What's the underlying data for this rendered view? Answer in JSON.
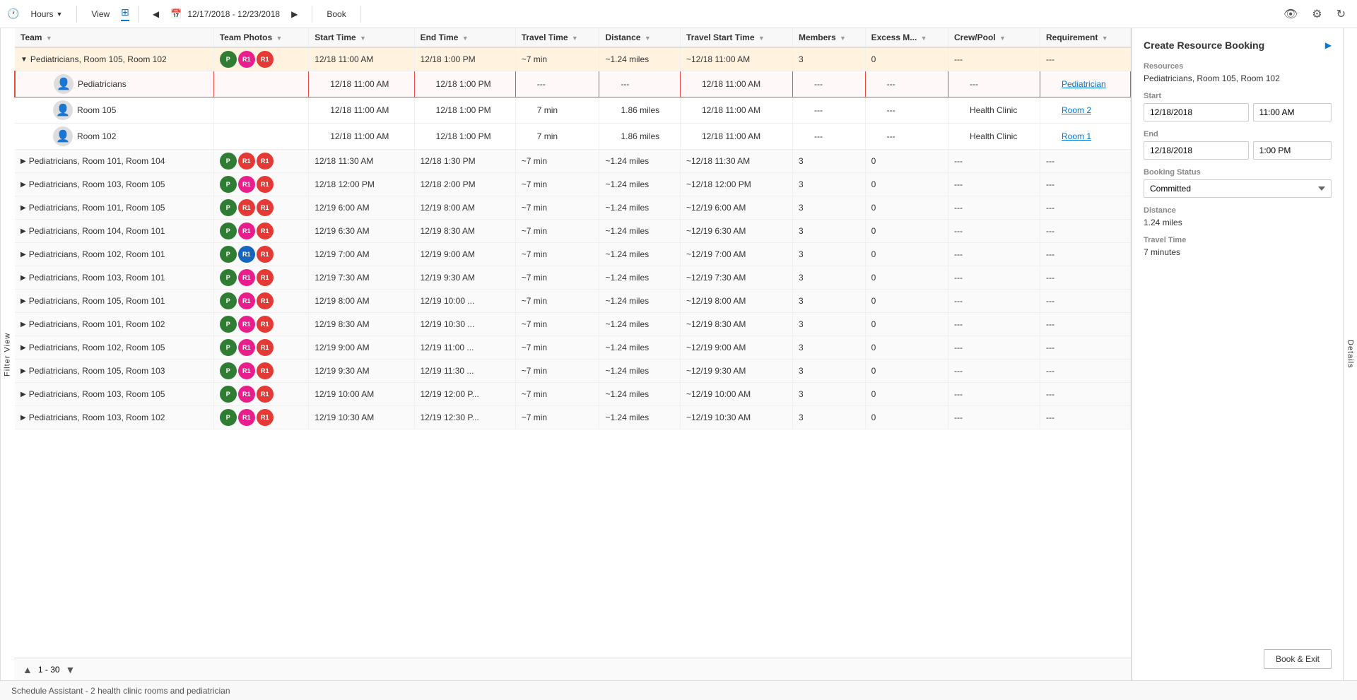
{
  "toolbar": {
    "hours_label": "Hours",
    "view_label": "View",
    "date_range": "12/17/2018 - 12/23/2018",
    "book_label": "Book"
  },
  "filter_tab": "Filter View",
  "details_tab": "Details",
  "columns": [
    {
      "key": "team",
      "label": "Team"
    },
    {
      "key": "team_photos",
      "label": "Team Photos"
    },
    {
      "key": "start_time",
      "label": "Start Time"
    },
    {
      "key": "end_time",
      "label": "End Time"
    },
    {
      "key": "travel_time",
      "label": "Travel Time"
    },
    {
      "key": "distance",
      "label": "Distance"
    },
    {
      "key": "travel_start_time",
      "label": "Travel Start Time"
    },
    {
      "key": "members",
      "label": "Members"
    },
    {
      "key": "excess_m",
      "label": "Excess M..."
    },
    {
      "key": "crew_pool",
      "label": "Crew/Pool"
    },
    {
      "key": "requirement",
      "label": "Requirement"
    }
  ],
  "rows": [
    {
      "id": "group1",
      "type": "group",
      "expanded": true,
      "team": "Pediatricians, Room 105, Room 102",
      "avatars": [
        {
          "letter": "P",
          "color": "green"
        },
        {
          "letter": "R1",
          "color": "pink"
        },
        {
          "letter": "R1",
          "color": "red"
        }
      ],
      "start_time": "12/18 11:00 AM",
      "end_time": "12/18 1:00 PM",
      "travel_time": "~7 min",
      "distance": "~1.24 miles",
      "travel_start_time": "~12/18 11:00 AM",
      "members": "3",
      "excess_m": "0",
      "crew_pool": "---",
      "requirement": "---"
    },
    {
      "id": "child1",
      "type": "child",
      "selected": true,
      "team": "Pediatricians",
      "person_icon": true,
      "avatars": [],
      "start_time": "12/18 11:00 AM",
      "end_time": "12/18 1:00 PM",
      "travel_time": "---",
      "distance": "---",
      "travel_start_time": "12/18 11:00 AM",
      "members": "---",
      "excess_m": "---",
      "crew_pool": "---",
      "requirement": "Pediatrician",
      "req_link": true
    },
    {
      "id": "child2",
      "type": "child",
      "team": "Room 105",
      "person_icon": true,
      "avatars": [],
      "start_time": "12/18 11:00 AM",
      "end_time": "12/18 1:00 PM",
      "travel_time": "7 min",
      "distance": "1.86 miles",
      "travel_start_time": "12/18 11:00 AM",
      "members": "---",
      "excess_m": "---",
      "crew_pool": "Health Clinic",
      "requirement": "Room 2",
      "req_link": true
    },
    {
      "id": "child3",
      "type": "child",
      "team": "Room 102",
      "person_icon": true,
      "avatars": [],
      "start_time": "12/18 11:00 AM",
      "end_time": "12/18 1:00 PM",
      "travel_time": "7 min",
      "distance": "1.86 miles",
      "travel_start_time": "12/18 11:00 AM",
      "members": "---",
      "excess_m": "---",
      "crew_pool": "Health Clinic",
      "requirement": "Room 1",
      "req_link": true
    },
    {
      "id": "group2",
      "type": "group",
      "expanded": false,
      "team": "Pediatricians, Room 101, Room 104",
      "avatars": [
        {
          "letter": "P",
          "color": "green"
        },
        {
          "letter": "R1",
          "color": "red"
        },
        {
          "letter": "R1",
          "color": "red"
        }
      ],
      "start_time": "12/18 11:30 AM",
      "end_time": "12/18 1:30 PM",
      "travel_time": "~7 min",
      "distance": "~1.24 miles",
      "travel_start_time": "~12/18 11:30 AM",
      "members": "3",
      "excess_m": "0",
      "crew_pool": "---",
      "requirement": "---"
    },
    {
      "id": "group3",
      "type": "group",
      "expanded": false,
      "team": "Pediatricians, Room 103, Room 105",
      "avatars": [
        {
          "letter": "P",
          "color": "green"
        },
        {
          "letter": "R1",
          "color": "pink"
        },
        {
          "letter": "R1",
          "color": "red"
        }
      ],
      "start_time": "12/18 12:00 PM",
      "end_time": "12/18 2:00 PM",
      "travel_time": "~7 min",
      "distance": "~1.24 miles",
      "travel_start_time": "~12/18 12:00 PM",
      "members": "3",
      "excess_m": "0",
      "crew_pool": "---",
      "requirement": "---"
    },
    {
      "id": "group4",
      "type": "group",
      "expanded": false,
      "team": "Pediatricians, Room 101, Room 105",
      "avatars": [
        {
          "letter": "P",
          "color": "green"
        },
        {
          "letter": "R1",
          "color": "red"
        },
        {
          "letter": "R1",
          "color": "red"
        }
      ],
      "start_time": "12/19 6:00 AM",
      "end_time": "12/19 8:00 AM",
      "travel_time": "~7 min",
      "distance": "~1.24 miles",
      "travel_start_time": "~12/19 6:00 AM",
      "members": "3",
      "excess_m": "0",
      "crew_pool": "---",
      "requirement": "---"
    },
    {
      "id": "group5",
      "type": "group",
      "expanded": false,
      "team": "Pediatricians, Room 104, Room 101",
      "avatars": [
        {
          "letter": "P",
          "color": "green"
        },
        {
          "letter": "R1",
          "color": "pink"
        },
        {
          "letter": "R1",
          "color": "red"
        }
      ],
      "start_time": "12/19 6:30 AM",
      "end_time": "12/19 8:30 AM",
      "travel_time": "~7 min",
      "distance": "~1.24 miles",
      "travel_start_time": "~12/19 6:30 AM",
      "members": "3",
      "excess_m": "0",
      "crew_pool": "---",
      "requirement": "---"
    },
    {
      "id": "group6",
      "type": "group",
      "expanded": false,
      "team": "Pediatricians, Room 102, Room 101",
      "avatars": [
        {
          "letter": "P",
          "color": "green"
        },
        {
          "letter": "R1",
          "color": "blue"
        },
        {
          "letter": "R1",
          "color": "red"
        }
      ],
      "start_time": "12/19 7:00 AM",
      "end_time": "12/19 9:00 AM",
      "travel_time": "~7 min",
      "distance": "~1.24 miles",
      "travel_start_time": "~12/19 7:00 AM",
      "members": "3",
      "excess_m": "0",
      "crew_pool": "---",
      "requirement": "---"
    },
    {
      "id": "group7",
      "type": "group",
      "expanded": false,
      "team": "Pediatricians, Room 103, Room 101",
      "avatars": [
        {
          "letter": "P",
          "color": "green"
        },
        {
          "letter": "R1",
          "color": "pink"
        },
        {
          "letter": "R1",
          "color": "red"
        }
      ],
      "start_time": "12/19 7:30 AM",
      "end_time": "12/19 9:30 AM",
      "travel_time": "~7 min",
      "distance": "~1.24 miles",
      "travel_start_time": "~12/19 7:30 AM",
      "members": "3",
      "excess_m": "0",
      "crew_pool": "---",
      "requirement": "---"
    },
    {
      "id": "group8",
      "type": "group",
      "expanded": false,
      "team": "Pediatricians, Room 105, Room 101",
      "avatars": [
        {
          "letter": "P",
          "color": "green"
        },
        {
          "letter": "R1",
          "color": "pink"
        },
        {
          "letter": "R1",
          "color": "red"
        }
      ],
      "start_time": "12/19 8:00 AM",
      "end_time": "12/19 10:00 ...",
      "travel_time": "~7 min",
      "distance": "~1.24 miles",
      "travel_start_time": "~12/19 8:00 AM",
      "members": "3",
      "excess_m": "0",
      "crew_pool": "---",
      "requirement": "---"
    },
    {
      "id": "group9",
      "type": "group",
      "expanded": false,
      "team": "Pediatricians, Room 101, Room 102",
      "avatars": [
        {
          "letter": "P",
          "color": "green"
        },
        {
          "letter": "R1",
          "color": "pink"
        },
        {
          "letter": "R1",
          "color": "red"
        }
      ],
      "start_time": "12/19 8:30 AM",
      "end_time": "12/19 10:30 ...",
      "travel_time": "~7 min",
      "distance": "~1.24 miles",
      "travel_start_time": "~12/19 8:30 AM",
      "members": "3",
      "excess_m": "0",
      "crew_pool": "---",
      "requirement": "---"
    },
    {
      "id": "group10",
      "type": "group",
      "expanded": false,
      "team": "Pediatricians, Room 102, Room 105",
      "avatars": [
        {
          "letter": "P",
          "color": "green"
        },
        {
          "letter": "R1",
          "color": "pink"
        },
        {
          "letter": "R1",
          "color": "red"
        }
      ],
      "start_time": "12/19 9:00 AM",
      "end_time": "12/19 11:00 ...",
      "travel_time": "~7 min",
      "distance": "~1.24 miles",
      "travel_start_time": "~12/19 9:00 AM",
      "members": "3",
      "excess_m": "0",
      "crew_pool": "---",
      "requirement": "---"
    },
    {
      "id": "group11",
      "type": "group",
      "expanded": false,
      "team": "Pediatricians, Room 105, Room 103",
      "avatars": [
        {
          "letter": "P",
          "color": "green"
        },
        {
          "letter": "R1",
          "color": "pink"
        },
        {
          "letter": "R1",
          "color": "red"
        }
      ],
      "start_time": "12/19 9:30 AM",
      "end_time": "12/19 11:30 ...",
      "travel_time": "~7 min",
      "distance": "~1.24 miles",
      "travel_start_time": "~12/19 9:30 AM",
      "members": "3",
      "excess_m": "0",
      "crew_pool": "---",
      "requirement": "---"
    },
    {
      "id": "group12",
      "type": "group",
      "expanded": false,
      "team": "Pediatricians, Room 103, Room 105",
      "avatars": [
        {
          "letter": "P",
          "color": "green"
        },
        {
          "letter": "R1",
          "color": "pink"
        },
        {
          "letter": "R1",
          "color": "red"
        }
      ],
      "start_time": "12/19 10:00 AM",
      "end_time": "12/19 12:00 P...",
      "travel_time": "~7 min",
      "distance": "~1.24 miles",
      "travel_start_time": "~12/19 10:00 AM",
      "members": "3",
      "excess_m": "0",
      "crew_pool": "---",
      "requirement": "---"
    },
    {
      "id": "group13",
      "type": "group",
      "expanded": false,
      "team": "Pediatricians, Room 103, Room 102",
      "avatars": [
        {
          "letter": "P",
          "color": "green"
        },
        {
          "letter": "R1",
          "color": "pink"
        },
        {
          "letter": "R1",
          "color": "red"
        }
      ],
      "start_time": "12/19 10:30 AM",
      "end_time": "12/19 12:30 P...",
      "travel_time": "~7 min",
      "distance": "~1.24 miles",
      "travel_start_time": "~12/19 10:30 AM",
      "members": "3",
      "excess_m": "0",
      "crew_pool": "---",
      "requirement": "---"
    }
  ],
  "pagination": {
    "current": "1 - 30"
  },
  "status_bar": "Schedule Assistant - 2 health clinic rooms and pediatrician",
  "right_panel": {
    "title": "Create Resource Booking",
    "resources_label": "Resources",
    "resources_value": "Pediatricians, Room 105, Room 102",
    "start_label": "Start",
    "start_date": "12/18/2018",
    "start_time": "11:00 AM",
    "end_label": "End",
    "end_date": "12/18/2018",
    "end_time": "1:00 PM",
    "booking_status_label": "Booking Status",
    "booking_status_value": "Committed",
    "distance_label": "Distance",
    "distance_value": "1.24 miles",
    "travel_time_label": "Travel Time",
    "travel_time_value": "7 minutes",
    "book_exit_label": "Book & Exit"
  }
}
